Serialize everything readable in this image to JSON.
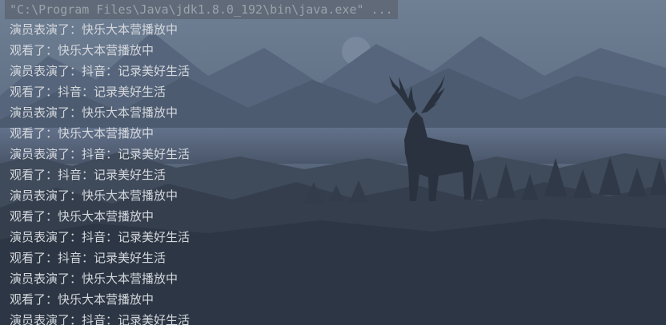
{
  "console": {
    "command": "\"C:\\Program Files\\Java\\jdk1.8.0_192\\bin\\java.exe\" ...",
    "lines": [
      "演员表演了：快乐大本营播放中",
      "观看了：快乐大本营播放中",
      "演员表演了：抖音：记录美好生活",
      "观看了：抖音：记录美好生活",
      "演员表演了：快乐大本营播放中",
      "观看了：快乐大本营播放中",
      "演员表演了：抖音：记录美好生活",
      "观看了：抖音：记录美好生活",
      "演员表演了：快乐大本营播放中",
      "观看了：快乐大本营播放中",
      "演员表演了：抖音：记录美好生活",
      "观看了：抖音：记录美好生活",
      "演员表演了：快乐大本营播放中",
      "观看了：快乐大本营播放中",
      "演员表演了：抖音：记录美好生活"
    ]
  },
  "colors": {
    "background": "#2b3340",
    "text": "#d4d8dd",
    "command_text": "#9aa2ab"
  }
}
